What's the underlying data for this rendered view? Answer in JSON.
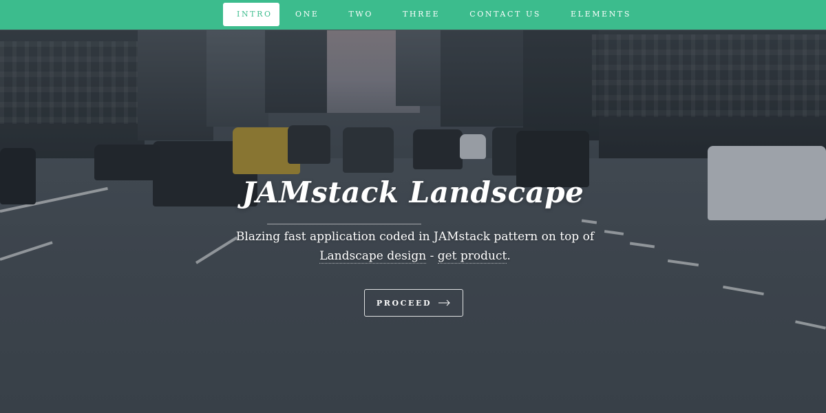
{
  "nav": {
    "items": [
      {
        "label": "INTRO",
        "active": true
      },
      {
        "label": "ONE",
        "active": false
      },
      {
        "label": "TWO",
        "active": false
      },
      {
        "label": "THREE",
        "active": false
      },
      {
        "label": "CONTACT US",
        "active": false
      },
      {
        "label": "ELEMENTS",
        "active": false
      }
    ]
  },
  "hero": {
    "title": "JAMstack Landscape",
    "subtitle_part1": "Blazing fast application coded in JAMstack pattern on top of",
    "subtitle_link1": "Landscape design",
    "subtitle_sep": " - ",
    "subtitle_link2": "get product",
    "subtitle_end": ".",
    "button_label": "PROCEED",
    "button_icon": "arrow-right-icon"
  },
  "colors": {
    "nav_bg": "#3cbc8d",
    "text": "#ffffff"
  }
}
